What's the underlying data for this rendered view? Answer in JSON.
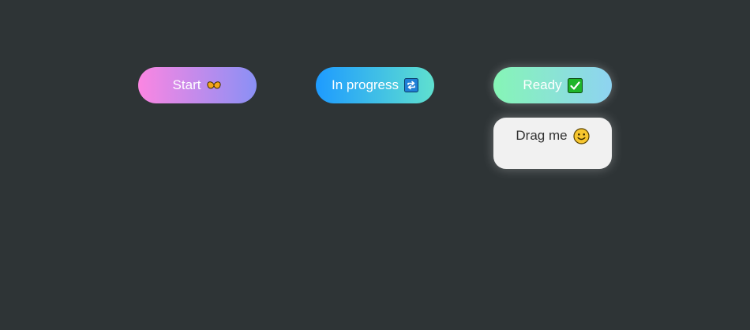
{
  "buttons": {
    "start": {
      "label": "Start",
      "icon": "wings-icon"
    },
    "in_progress": {
      "label": "In progress",
      "icon": "repeat-icon"
    },
    "ready": {
      "label": "Ready",
      "icon": "check-mark-icon"
    }
  },
  "drag_card": {
    "label": "Drag me",
    "icon": "smiley-icon"
  },
  "colors": {
    "background": "#2e3436",
    "start_gradient": [
      "#fb86e2",
      "#8a90f5"
    ],
    "progress_gradient": [
      "#1e9bff",
      "#5fe0cf"
    ],
    "ready_gradient": [
      "#86f5b6",
      "#8ed3f1"
    ],
    "card_background": "#f1f1f1"
  }
}
